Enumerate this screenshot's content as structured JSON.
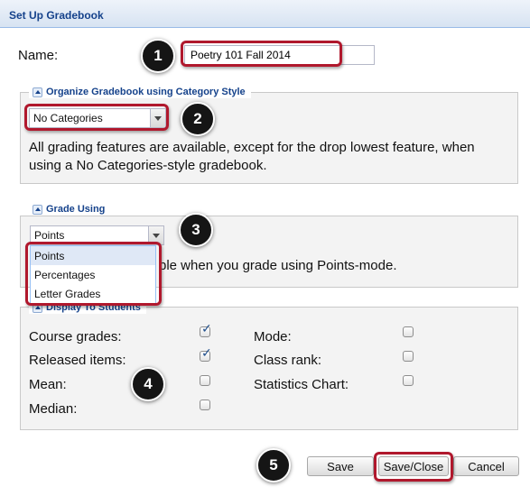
{
  "panel": {
    "title": "Set Up Gradebook"
  },
  "name_field": {
    "label": "Name:",
    "value": "Poetry 101 Fall 2014"
  },
  "category_style": {
    "legend": "Organize Gradebook using Category Style",
    "selected": "No Categories",
    "description_line1": "All grading features are available, except for the drop lowest feature, when",
    "description_line2": "using a No Categories-style gradebook."
  },
  "grade_using": {
    "legend": "Grade Using",
    "selected": "Points",
    "options": [
      "Points",
      "Percentages",
      "Letter Grades"
    ],
    "partial_description": "ble when you grade using Points-mode."
  },
  "display_to_students": {
    "legend": "Display To Students",
    "left": [
      {
        "label": "Course grades:",
        "checked": true
      },
      {
        "label": "Released items:",
        "checked": true
      },
      {
        "label": "Mean:",
        "checked": false
      },
      {
        "label": "Median:",
        "checked": false
      }
    ],
    "right": [
      {
        "label": "Mode:",
        "checked": false
      },
      {
        "label": "Class rank:",
        "checked": false
      },
      {
        "label": "Statistics Chart:",
        "checked": false
      }
    ]
  },
  "buttons": {
    "save": "Save",
    "save_close": "Save/Close",
    "cancel": "Cancel"
  },
  "callouts": [
    "1",
    "2",
    "3",
    "4",
    "5"
  ],
  "colors": {
    "highlight": "#b0182d",
    "header_text": "#15428b",
    "badge": "#151515"
  },
  "icons": {
    "collapse": "collapse-up-icon",
    "dropdown": "chevron-down-icon",
    "checkmark": "checkmark-icon"
  }
}
